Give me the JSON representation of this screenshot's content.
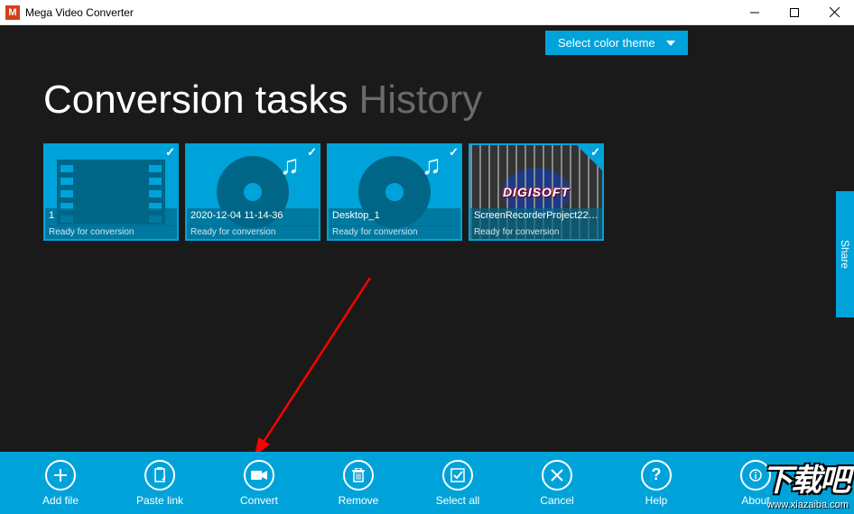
{
  "window": {
    "title": "Mega Video Converter",
    "icon_letter": "M"
  },
  "theme_button": "Select color theme",
  "heading": {
    "active": "Conversion tasks",
    "inactive": "History"
  },
  "share_label": "Share",
  "tiles": [
    {
      "name": "1",
      "status": "Ready for conversion",
      "kind": "film"
    },
    {
      "name": "2020-12-04 11-14-36",
      "status": "Ready for conversion",
      "kind": "disc"
    },
    {
      "name": "Desktop_1",
      "status": "Ready for conversion",
      "kind": "disc"
    },
    {
      "name": "ScreenRecorderProject220...",
      "status": "Ready for conversion",
      "kind": "screenshot"
    }
  ],
  "toolbar": [
    {
      "id": "add-file",
      "label": "Add file",
      "icon": "plus"
    },
    {
      "id": "paste-link",
      "label": "Paste link",
      "icon": "clipboard"
    },
    {
      "id": "convert",
      "label": "Convert",
      "icon": "camera"
    },
    {
      "id": "remove",
      "label": "Remove",
      "icon": "trash"
    },
    {
      "id": "select-all",
      "label": "Select all",
      "icon": "checkbox"
    },
    {
      "id": "cancel",
      "label": "Cancel",
      "icon": "x"
    },
    {
      "id": "help",
      "label": "Help",
      "icon": "question"
    },
    {
      "id": "about",
      "label": "About",
      "icon": "info"
    }
  ],
  "watermark": {
    "big": "下载吧",
    "url": "www.xiazaiba.com"
  },
  "thumb_logo": "DIGISOFT"
}
